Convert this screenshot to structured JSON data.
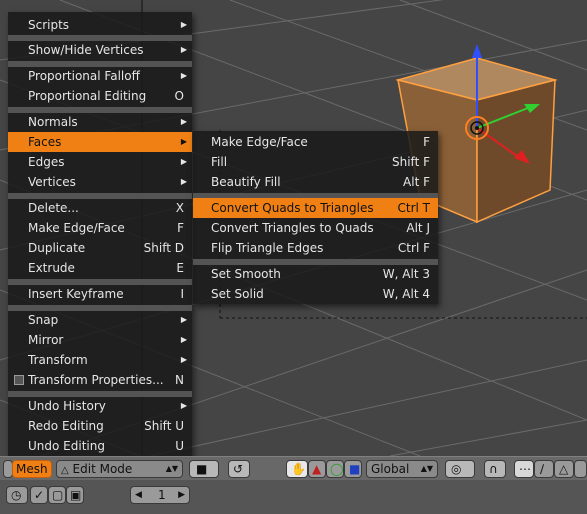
{
  "mesh_menu": {
    "items": [
      {
        "label": "Scripts",
        "shortcut": "",
        "submenu": true
      },
      {
        "label": "Show/Hide Vertices",
        "shortcut": "",
        "submenu": true
      },
      {
        "label": "Proportional Falloff",
        "shortcut": "",
        "submenu": true
      },
      {
        "label": "Proportional Editing",
        "shortcut": "O",
        "submenu": false
      },
      {
        "label": "Normals",
        "shortcut": "",
        "submenu": true
      },
      {
        "label": "Faces",
        "shortcut": "",
        "submenu": true
      },
      {
        "label": "Edges",
        "shortcut": "",
        "submenu": true
      },
      {
        "label": "Vertices",
        "shortcut": "",
        "submenu": true
      },
      {
        "label": "Delete...",
        "shortcut": "X",
        "submenu": false
      },
      {
        "label": "Make Edge/Face",
        "shortcut": "F",
        "submenu": false
      },
      {
        "label": "Duplicate",
        "shortcut": "Shift D",
        "submenu": false
      },
      {
        "label": "Extrude",
        "shortcut": "E",
        "submenu": false
      },
      {
        "label": "Insert Keyframe",
        "shortcut": "I",
        "submenu": false
      },
      {
        "label": "Snap",
        "shortcut": "",
        "submenu": true
      },
      {
        "label": "Mirror",
        "shortcut": "",
        "submenu": true
      },
      {
        "label": "Transform",
        "shortcut": "",
        "submenu": true
      },
      {
        "label": "Transform Properties...",
        "shortcut": "N",
        "submenu": false
      },
      {
        "label": "Undo History",
        "shortcut": "",
        "submenu": true
      },
      {
        "label": "Redo Editing",
        "shortcut": "Shift U",
        "submenu": false
      },
      {
        "label": "Undo Editing",
        "shortcut": "U",
        "submenu": false
      }
    ]
  },
  "faces_submenu": {
    "items": [
      {
        "label": "Make Edge/Face",
        "shortcut": "F"
      },
      {
        "label": "Fill",
        "shortcut": "Shift F"
      },
      {
        "label": "Beautify Fill",
        "shortcut": "Alt F"
      },
      {
        "label": "Convert Quads to Triangles",
        "shortcut": "Ctrl T"
      },
      {
        "label": "Convert Triangles to Quads",
        "shortcut": "Alt J"
      },
      {
        "label": "Flip Triangle Edges",
        "shortcut": "Ctrl F"
      },
      {
        "label": "Set Smooth",
        "shortcut": "W, Alt 3"
      },
      {
        "label": "Set Solid",
        "shortcut": "W, Alt 4"
      }
    ]
  },
  "header": {
    "mesh_menu_label": "Mesh",
    "mode_label": "Edit Mode",
    "orientation_label": "Global"
  },
  "statusbar": {
    "frame_value": "1"
  },
  "colors": {
    "highlight": "#f08014",
    "selection": "#ffa040"
  }
}
